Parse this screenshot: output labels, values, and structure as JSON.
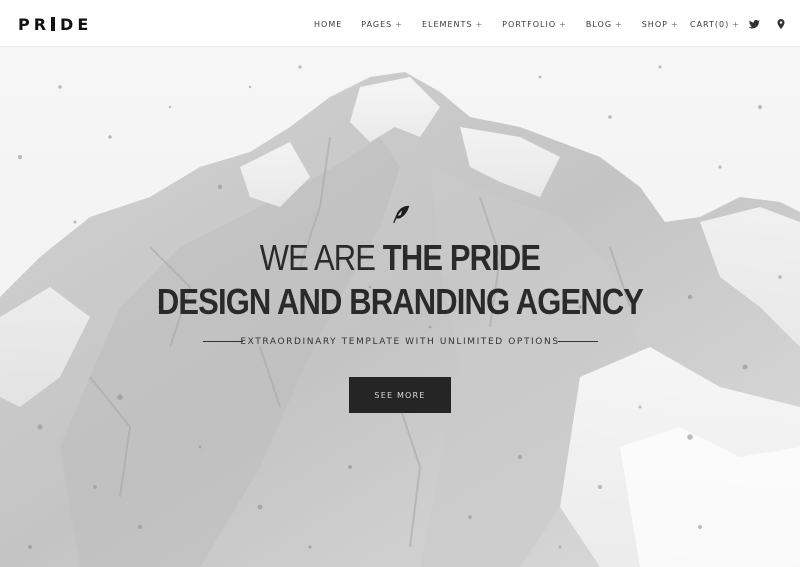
{
  "header": {
    "logo": {
      "left": "PR",
      "right": "DE"
    },
    "nav": [
      {
        "label": "HOME",
        "has_submenu": false
      },
      {
        "label": "PAGES",
        "has_submenu": true
      },
      {
        "label": "ELEMENTS",
        "has_submenu": true
      },
      {
        "label": "PORTFOLIO",
        "has_submenu": true
      },
      {
        "label": "BLOG",
        "has_submenu": true
      },
      {
        "label": "SHOP",
        "has_submenu": true
      }
    ],
    "submenu_marker": "+",
    "cart_label": "CART(0)",
    "icons": [
      "twitter-icon",
      "map-pin-icon"
    ]
  },
  "hero": {
    "icon": "feather-icon",
    "headline_line1_light": "WE ARE ",
    "headline_line1_bold": "THE PRIDE",
    "headline_line2": "DESIGN AND BRANDING AGENCY",
    "tagline": "EXTRAORDINARY TEMPLATE WITH UNLIMITED OPTIONS",
    "cta_label": "SEE MORE"
  },
  "colors": {
    "header_bg": "#ffffff",
    "text_dark": "#2a2a2a",
    "button_bg": "#252525",
    "button_text": "#d8d8d8",
    "hero_bg": "#f4f4f4"
  }
}
